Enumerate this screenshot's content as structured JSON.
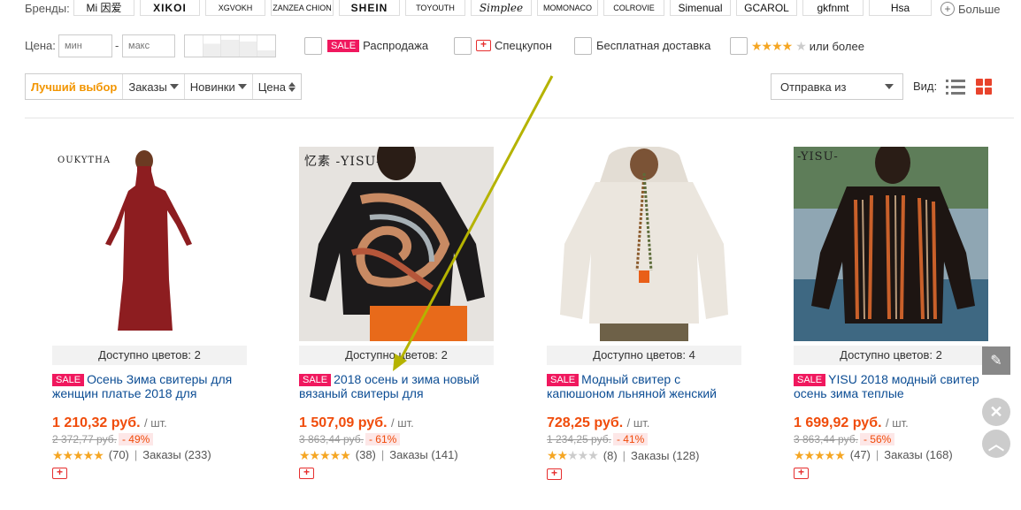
{
  "brands": {
    "label": "Бренды:",
    "items": [
      "Mi 因爱",
      "XIKOI",
      "XGVOKH",
      "ZANZEA CHION",
      "SHEIN",
      "TOYOUTH",
      "Simplee",
      "MOMONACO",
      "COLROVIE",
      "Simenual",
      "GCAROL",
      "gkfnmt",
      "Hsa"
    ],
    "more_label": "Больше"
  },
  "filters": {
    "price_label": "Цена:",
    "min_placeholder": "мин",
    "max_placeholder": "макс",
    "dash": "-",
    "sale_badge": "SALE",
    "sale_label": "Распродажа",
    "coupon_label": "Спецкупон",
    "free_shipping_label": "Бесплатная доставка",
    "rating_stars": 4,
    "rating_label": "или более"
  },
  "sort": {
    "items": [
      "Лучший выбор",
      "Заказы",
      "Новинки",
      "Цена"
    ],
    "ship_from_label": "Отправка из",
    "view_label": "Вид:"
  },
  "colors": {
    "accent_orange": "#f29500",
    "price_red": "#f04c0b",
    "sale_pink": "#f0185e",
    "grid_icon_red": "#e8432c",
    "link_blue": "#0c4d94",
    "arrow_olive": "#b5b300"
  },
  "products": [
    {
      "brandmark": "OUKYTHA",
      "colors_available": "Доступно цветов: 2",
      "sale_badge": "SALE",
      "title": "Осень Зима свитеры для женщин платье 2018 для",
      "price": "1 210,32 руб.",
      "unit": "/ шт.",
      "old_price": "2 372,77 руб.",
      "discount": "- 49%",
      "stars": 5,
      "reviews": "(70)",
      "sep": "|",
      "orders": "Заказы (233)"
    },
    {
      "brandmark": "忆素 -YISU-",
      "colors_available": "Доступно цветов: 2",
      "sale_badge": "SALE",
      "title": "2018 осень и зима новый вязаный свитеры для",
      "price": "1 507,09 руб.",
      "unit": "/ шт.",
      "old_price": "3 863,44 руб.",
      "discount": "- 61%",
      "stars": 5,
      "reviews": "(38)",
      "sep": "|",
      "orders": "Заказы (141)"
    },
    {
      "brandmark": "",
      "colors_available": "Доступно цветов: 4",
      "sale_badge": "SALE",
      "title": "Модный свитер с капюшоном льняной женский",
      "price": "728,25 руб.",
      "unit": "/ шт.",
      "old_price": "1 234,25 руб.",
      "discount": "- 41%",
      "stars": 2,
      "reviews": "(8)",
      "sep": "|",
      "orders": "Заказы (128)"
    },
    {
      "brandmark": "-YISU-",
      "colors_available": "Доступно цветов: 2",
      "sale_badge": "SALE",
      "title": "YISU 2018 модный свитер осень зима теплые",
      "price": "1 699,92 руб.",
      "unit": "/ шт.",
      "old_price": "3 863,44 руб.",
      "discount": "- 56%",
      "stars": 5,
      "reviews": "(47)",
      "sep": "|",
      "orders": "Заказы (168)"
    }
  ],
  "side_tools": {
    "edit_icon": "pencil-icon",
    "close_icon": "close-icon",
    "top_icon": "chevron-up-icon"
  }
}
